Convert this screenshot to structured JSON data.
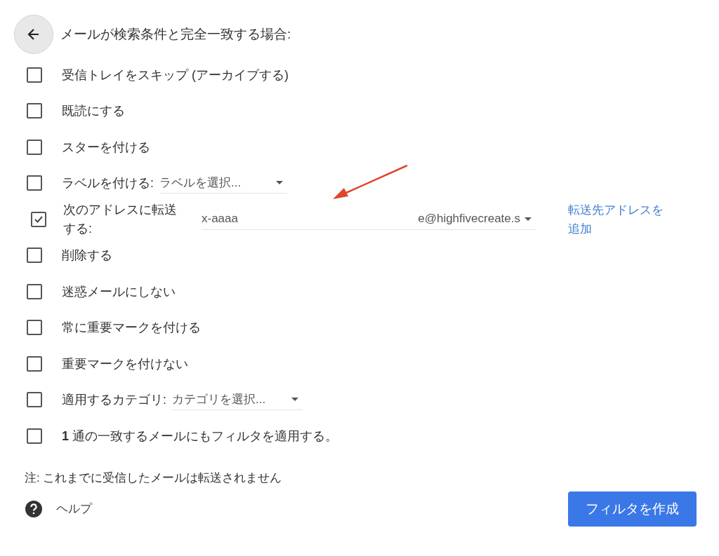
{
  "header": {
    "title": "メールが検索条件と完全一致する場合:"
  },
  "actions": [
    {
      "kind": "plain",
      "label": "受信トレイをスキップ (アーカイブする)",
      "checked": false
    },
    {
      "kind": "plain",
      "label": "既読にする",
      "checked": false
    },
    {
      "kind": "plain",
      "label": "スターを付ける",
      "checked": false
    },
    {
      "kind": "select",
      "label": "ラベルを付ける:",
      "select": "ラベルを選択...",
      "checked": false
    },
    {
      "kind": "forward",
      "label": "次のアドレスに転送する:",
      "value_parts": [
        "x-aaaa",
        "e@highfivecreate.s"
      ],
      "link": "転送先アドレスを追加",
      "checked": true
    },
    {
      "kind": "plain",
      "label": "削除する",
      "checked": false
    },
    {
      "kind": "plain",
      "label": "迷惑メールにしない",
      "checked": false
    },
    {
      "kind": "plain",
      "label": "常に重要マークを付ける",
      "checked": false
    },
    {
      "kind": "plain",
      "label": "重要マークを付けない",
      "checked": false
    },
    {
      "kind": "select",
      "label": "適用するカテゴリ:",
      "select": "カテゴリを選択...",
      "checked": false
    },
    {
      "kind": "plain",
      "label": "**1** 通の一致するメールにもフィルタを適用する。",
      "checked": false
    }
  ],
  "note": "注: これまでに受信したメールは転送されません",
  "help": "ヘルプ",
  "create_button": "フィルタを作成"
}
